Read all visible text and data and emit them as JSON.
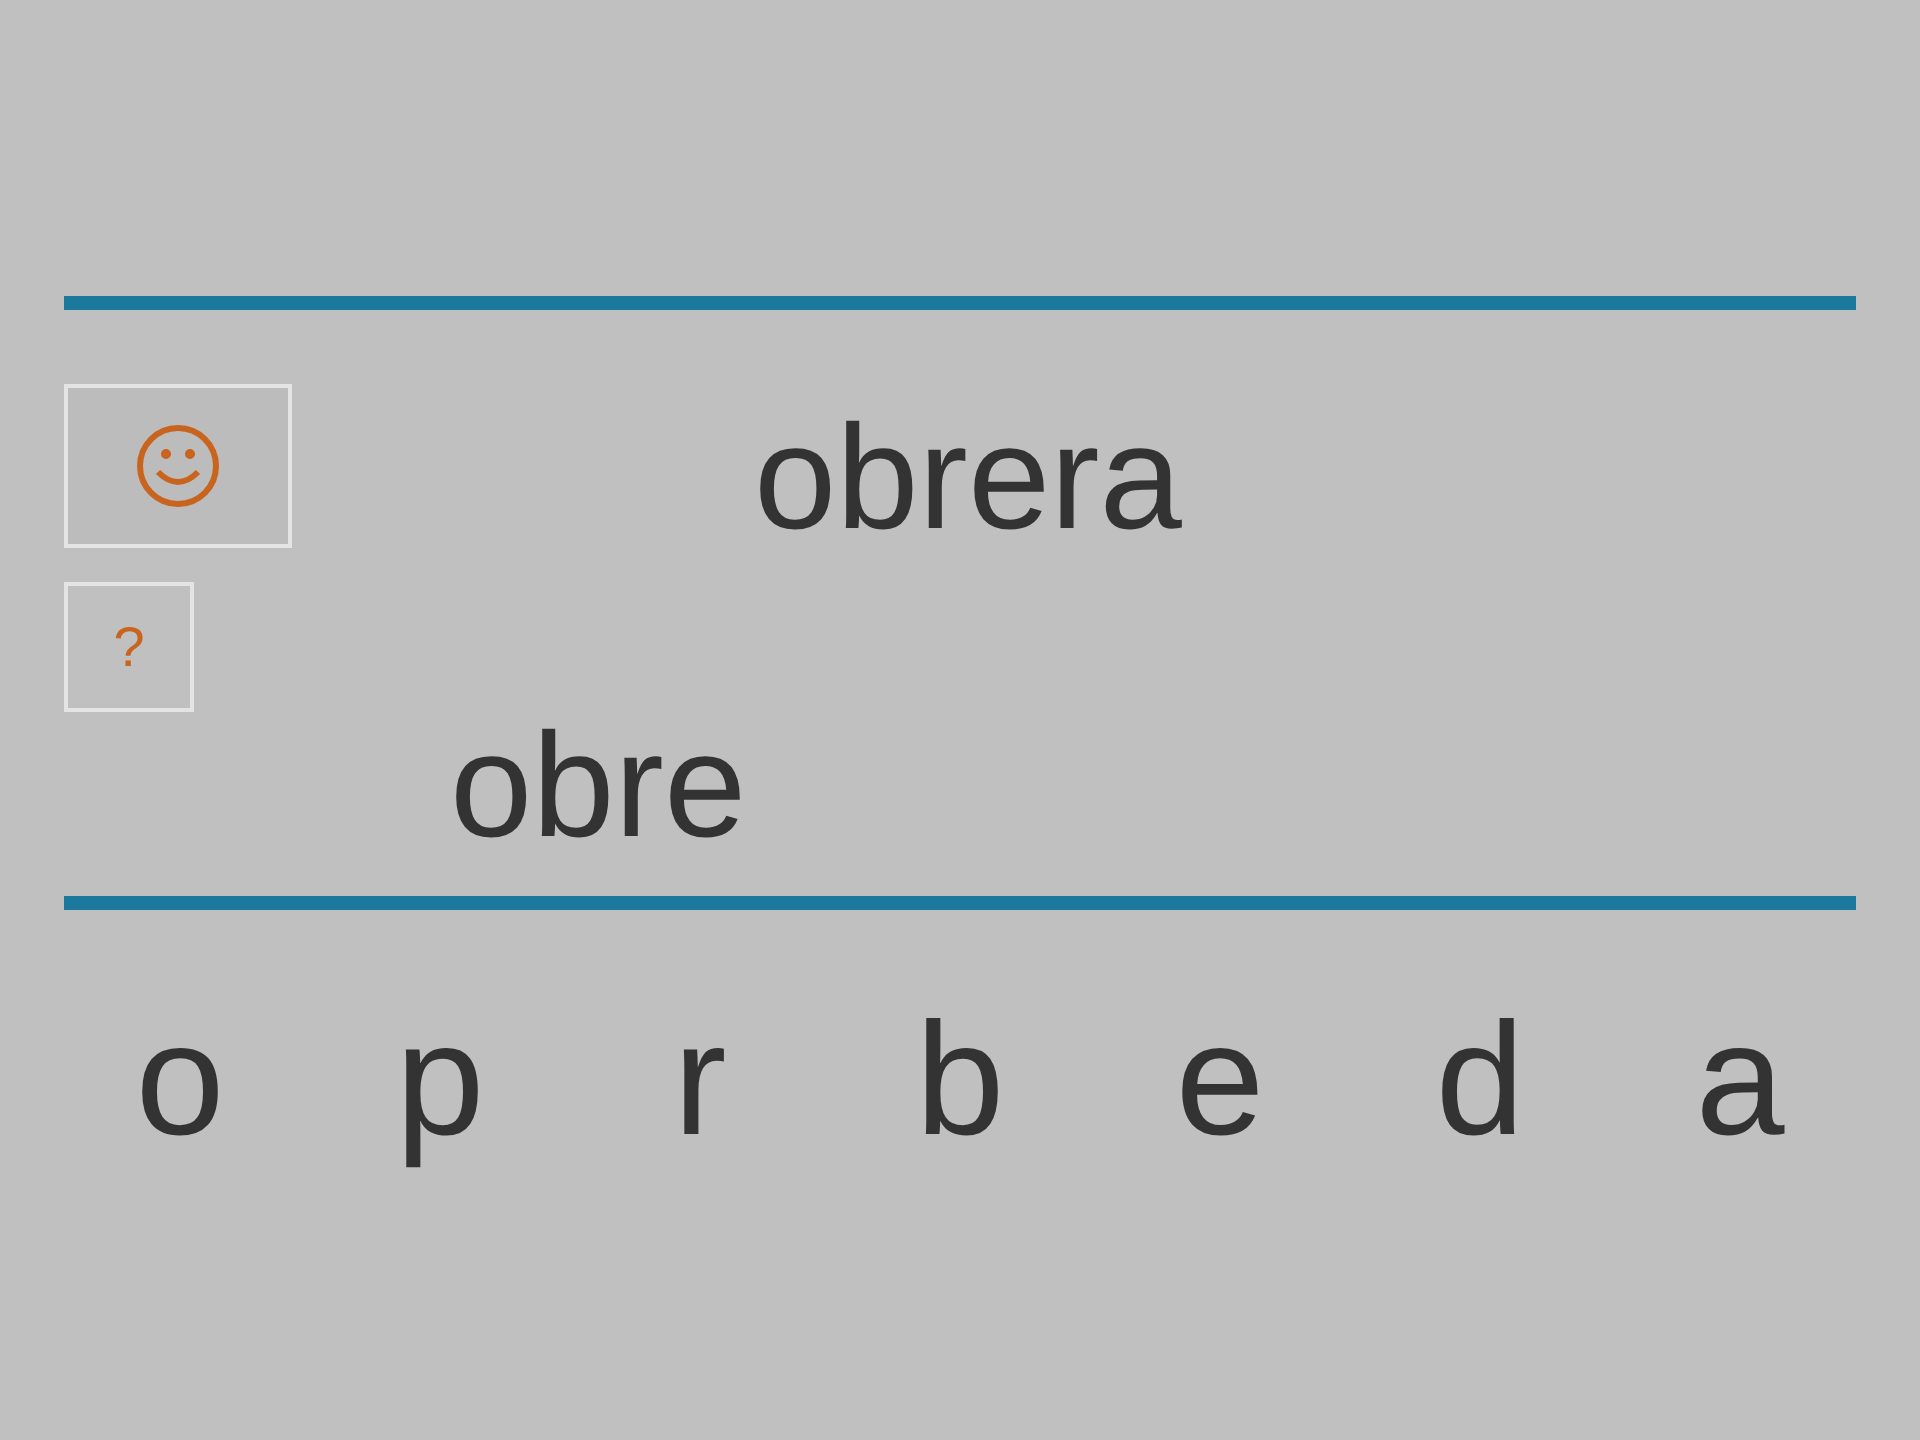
{
  "target_word": "obrera",
  "hint_button": {
    "label": "?"
  },
  "answer": "obre",
  "letters": [
    "o",
    "p",
    "r",
    "b",
    "e",
    "d",
    "a"
  ]
}
